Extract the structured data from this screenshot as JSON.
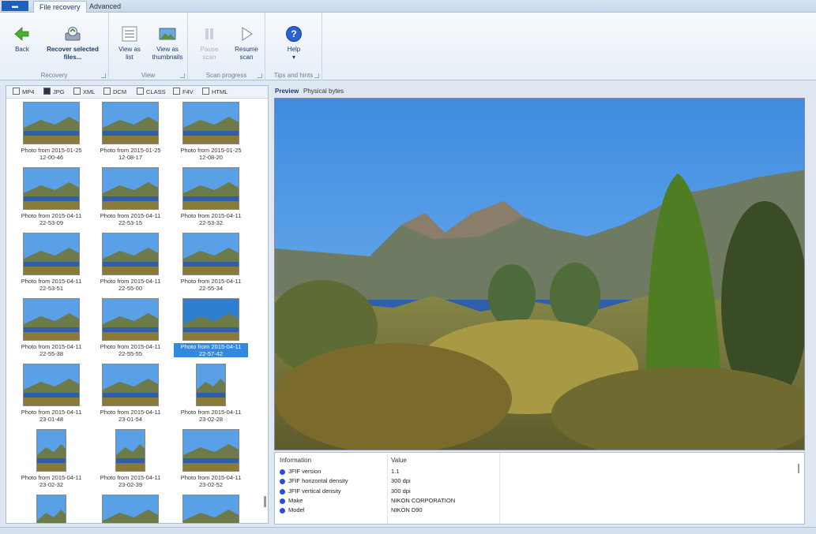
{
  "tabs": {
    "app_menu": "",
    "file_recovery": "File recovery",
    "advanced": "Advanced"
  },
  "ribbon": {
    "recovery": {
      "label": "Recovery",
      "back": "Back",
      "recover_selected_1": "Recover selected",
      "recover_selected_2": "files..."
    },
    "view": {
      "label": "View",
      "list_1": "View as",
      "list_2": "list",
      "thumbs_1": "View as",
      "thumbs_2": "thumbnails"
    },
    "scan": {
      "label": "Scan progress",
      "pause_1": "Pause",
      "pause_2": "scan",
      "resume_1": "Resume",
      "resume_2": "scan"
    },
    "tips": {
      "label": "Tips and hints",
      "help": "Help"
    }
  },
  "file_types": [
    "MP4",
    "JPG",
    "XML",
    "DCM",
    "CLASS",
    "F4V",
    "HTML"
  ],
  "selected_file_type": "JPG",
  "thumbnails": [
    {
      "line1": "Photo from 2015-01-25",
      "line2": "12-00-46",
      "kind": "landscape"
    },
    {
      "line1": "Photo from 2015-01-25",
      "line2": "12-08-17",
      "kind": "landscape"
    },
    {
      "line1": "Photo from 2015-01-25",
      "line2": "12-08-20",
      "kind": "landscape"
    },
    {
      "line1": "Photo from 2015-04-11",
      "line2": "22-53-09",
      "kind": "landscape"
    },
    {
      "line1": "Photo from 2015-04-11",
      "line2": "22-53-15",
      "kind": "landscape"
    },
    {
      "line1": "Photo from 2015-04-11",
      "line2": "22-53-32",
      "kind": "landscape"
    },
    {
      "line1": "Photo from 2015-04-11",
      "line2": "22-53-51",
      "kind": "landscape"
    },
    {
      "line1": "Photo from 2015-04-11",
      "line2": "22-55-00",
      "kind": "landscape"
    },
    {
      "line1": "Photo from 2015-04-11",
      "line2": "22-55-34",
      "kind": "landscape"
    },
    {
      "line1": "Photo from 2015-04-11",
      "line2": "22-55-38",
      "kind": "landscape"
    },
    {
      "line1": "Photo from 2015-04-11",
      "line2": "22-55-55",
      "kind": "landscape"
    },
    {
      "line1": "Photo from 2015-04-11",
      "line2": "22-57-42",
      "kind": "landscape",
      "selected": true
    },
    {
      "line1": "Photo from 2015-04-11",
      "line2": "23-01-48",
      "kind": "landscape"
    },
    {
      "line1": "Photo from 2015-04-11",
      "line2": "23-01-54",
      "kind": "landscape"
    },
    {
      "line1": "Photo from 2015-04-11",
      "line2": "23-02-28",
      "kind": "portrait"
    },
    {
      "line1": "Photo from 2015-04-11",
      "line2": "23-02-32",
      "kind": "portrait"
    },
    {
      "line1": "Photo from 2015-04-11",
      "line2": "23-02-39",
      "kind": "portrait"
    },
    {
      "line1": "Photo from 2015-04-11",
      "line2": "23-02-52",
      "kind": "landscape"
    },
    {
      "line1": "",
      "line2": "",
      "kind": "portrait"
    },
    {
      "line1": "",
      "line2": "",
      "kind": "landscape"
    },
    {
      "line1": "",
      "line2": "",
      "kind": "landscape"
    }
  ],
  "preview_tabs": {
    "preview": "Preview",
    "physical": "Physical bytes"
  },
  "info": {
    "header_info": "Information",
    "header_value": "Value",
    "rows": [
      {
        "key": "JFIF version",
        "value": "1.1"
      },
      {
        "key": "JFIF horizontal density",
        "value": "300 dpi"
      },
      {
        "key": "JFIF vertical density",
        "value": "300 dpi"
      },
      {
        "key": "Make",
        "value": "NIKON CORPORATION"
      },
      {
        "key": "Model",
        "value": "NIKON D90"
      }
    ]
  },
  "colors": {
    "accent": "#1e3c6e",
    "selection": "#3388e0",
    "info_bullet": "#2a4fd0"
  }
}
